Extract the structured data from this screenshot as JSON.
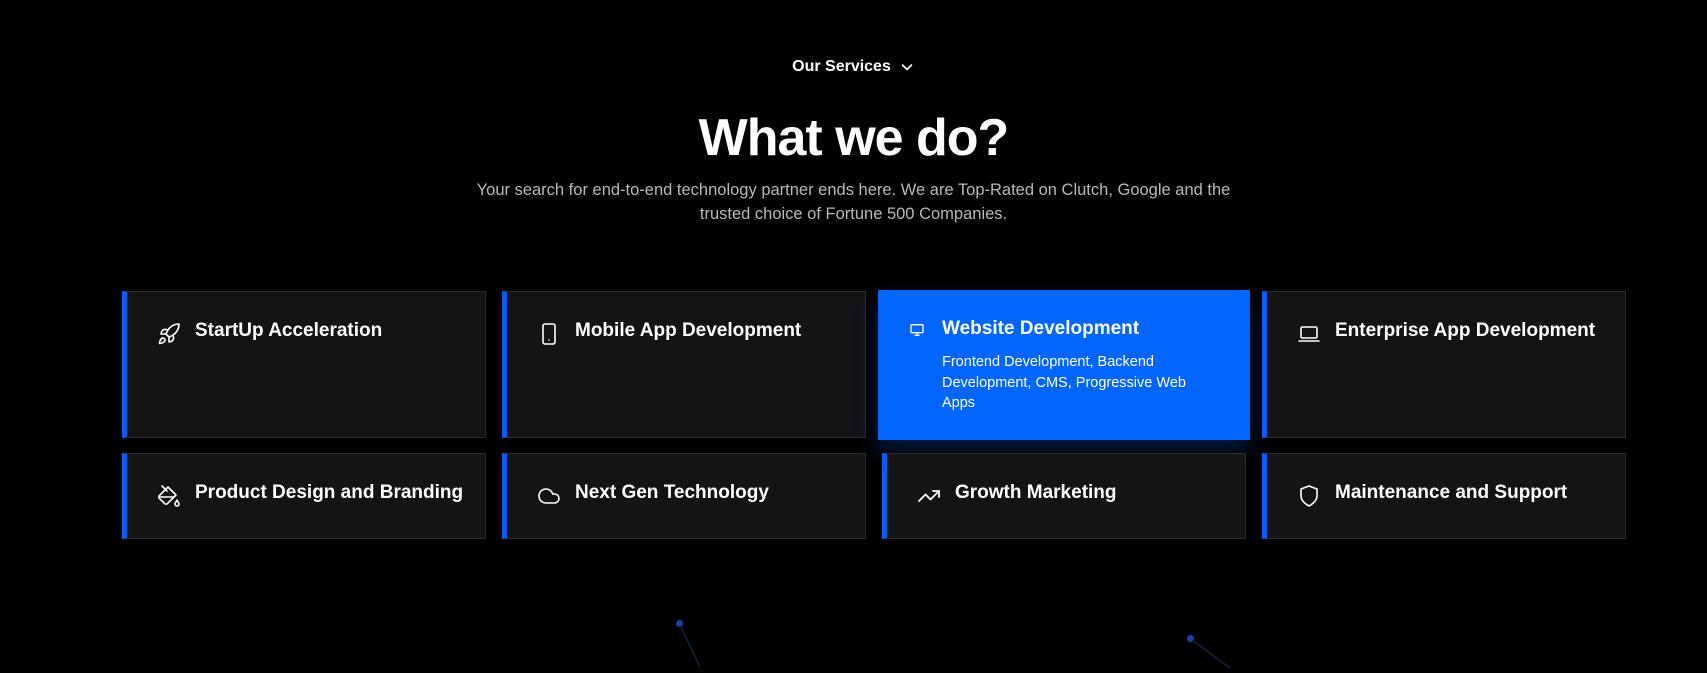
{
  "header": {
    "eyebrow": "Our Services",
    "title": "What we do?",
    "subtitle": "Your search for end-to-end technology partner ends here. We are Top-Rated on Clutch, Google and the trusted choice of Fortune 500 Companies."
  },
  "services": [
    {
      "label": "StartUp Acceleration",
      "icon": "rocket-icon"
    },
    {
      "label": "Mobile App Development",
      "icon": "smartphone-icon"
    },
    {
      "label": "Website Development",
      "icon": "monitor-icon",
      "active": true,
      "description": "Frontend Development, Backend Development, CMS, Progressive Web Apps"
    },
    {
      "label": "Enterprise App Development",
      "icon": "laptop-icon"
    },
    {
      "label": "Product Design and Branding",
      "icon": "paint-bucket-icon"
    },
    {
      "label": "Next Gen Technology",
      "icon": "cloud-icon"
    },
    {
      "label": "Growth Marketing",
      "icon": "trending-up-icon"
    },
    {
      "label": "Maintenance and Support",
      "icon": "shield-icon"
    }
  ],
  "colors": {
    "background": "#000000",
    "accent": "#0066ff",
    "card": "#141414",
    "card_border": "#2c2c2c",
    "subtitle": "#b8b8b8"
  }
}
